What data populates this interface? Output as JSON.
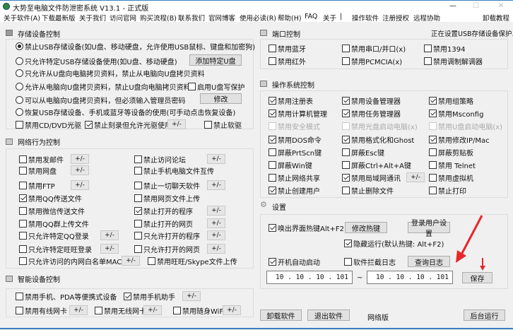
{
  "window": {
    "title": "大势至电脑文件防泄密系统 V13.1 - 正式版",
    "minimize": "—",
    "maximize": "☐",
    "close": "✕"
  },
  "menu": [
    "关于软件(A)",
    "下载最新版",
    "关于我们",
    "访问官网",
    "购买流程(B)",
    "联系我们",
    "官网博客",
    "使用必读(R)",
    "帮助(H)",
    "FAQ",
    "关于",
    "|",
    "操作软件",
    "注册授权",
    "远程协助",
    "卸载教程"
  ],
  "storage": {
    "title": "存储设备控制",
    "radios": [
      {
        "label": "禁止USB存储设备(如U盘、移动硬盘，允许使用USB鼠标、键盘和加密狗)",
        "checked": true
      },
      {
        "label": "只允许特定USB存储设备使用(如U盘、移动硬盘)",
        "checked": false
      },
      {
        "label": "只允许从U盘向电脑拷贝资料，禁止从电脑向U盘拷贝资料",
        "checked": false
      },
      {
        "label": "允许从电脑向U盘拷贝资料，禁止U盘向电脑拷贝资料",
        "checked": false
      },
      {
        "label": "可以从电脑向U盘拷贝资料，但必须输入管理员密码",
        "checked": false
      },
      {
        "label": "恢复USB存储设备、手机或蓝牙等设备的使用(可手动点击恢复设备)",
        "checked": false
      }
    ],
    "add_usb_button": "添加特定U盘",
    "modify_button": "修改",
    "write_protect": {
      "label": "启用U盘写保护",
      "checked": false
    },
    "cd": {
      "label": "禁用CD/DVD光驱",
      "checked": false
    },
    "burn": {
      "label": "禁止刻录但允许光驱使用",
      "checked": true
    },
    "floppy": {
      "label": "禁止软驱",
      "checked": false
    },
    "pm": "+/-"
  },
  "network": {
    "title": "网络行为控制",
    "items": [
      {
        "label": "禁用发邮件",
        "checked": false
      },
      {
        "label": "禁用网盘",
        "checked": false
      },
      {
        "label": "禁用FTP",
        "checked": false
      },
      {
        "label": "禁用QQ传送文件",
        "checked": true
      },
      {
        "label": "禁用微信传送文件",
        "checked": false
      },
      {
        "label": "禁用QQ群上传文件",
        "checked": false
      },
      {
        "label": "只允许特定QQ登录",
        "checked": false
      },
      {
        "label": "只允许特定旺旺登录",
        "checked": false
      },
      {
        "label": "只允许访问的内网白名单MAC列表",
        "checked": false
      },
      {
        "label": "禁止访问论坛",
        "checked": false
      },
      {
        "label": "禁止手机电脑文件互传",
        "checked": false
      },
      {
        "label": "禁止一切聊天软件",
        "checked": false
      },
      {
        "label": "禁用网页文件上传",
        "checked": false
      },
      {
        "label": "禁止打开的程序",
        "checked": true
      },
      {
        "label": "禁止打开的网页",
        "checked": false
      },
      {
        "label": "只允许打开的程序",
        "checked": false
      },
      {
        "label": "只允许打开的网页",
        "checked": false
      },
      {
        "label": "禁用旺旺/Skype文件上传",
        "checked": false
      }
    ]
  },
  "smart": {
    "title": "智能设备控制",
    "items": [
      {
        "label": "禁用手机、PDA等便携式设备",
        "checked": false
      },
      {
        "label": "禁用手机助手",
        "checked": true
      },
      {
        "label": "禁用有线网卡",
        "checked": false
      },
      {
        "label": "禁用无线网卡",
        "checked": false
      },
      {
        "label": "禁用随身WiFi",
        "checked": false
      }
    ]
  },
  "port": {
    "title": "端口控制",
    "status": "正在设置USB存储设备保护...",
    "items": [
      {
        "label": "禁用蓝牙",
        "checked": false
      },
      {
        "label": "禁用串口/并口(x)",
        "checked": false
      },
      {
        "label": "禁用1394",
        "checked": false
      },
      {
        "label": "禁用红外",
        "checked": false
      },
      {
        "label": "禁用PCMCIA(x)",
        "checked": false
      },
      {
        "label": "禁用调制解调器",
        "checked": false
      }
    ]
  },
  "os": {
    "title": "操作系统控制",
    "items": [
      {
        "label": "禁用注册表",
        "checked": true
      },
      {
        "label": "禁用设备管理器",
        "checked": true
      },
      {
        "label": "禁用组策略",
        "checked": true
      },
      {
        "label": "禁用计算机管理",
        "checked": true
      },
      {
        "label": "禁用任务管理器",
        "checked": true
      },
      {
        "label": "禁用Msconfig",
        "checked": true
      },
      {
        "label": "禁用安全模式",
        "checked": false
      },
      {
        "label": "禁用光盘启动电脑(x)",
        "checked": false
      },
      {
        "label": "禁用U盘启动电脑(x)",
        "checked": false
      },
      {
        "label": "禁用DOS命令",
        "checked": true
      },
      {
        "label": "禁用格式化和Ghost",
        "checked": true
      },
      {
        "label": "禁用修改IP/Mac",
        "checked": true
      },
      {
        "label": "屏蔽PrtScn键",
        "checked": false
      },
      {
        "label": "屏蔽Esc键",
        "checked": false
      },
      {
        "label": "屏蔽剪贴板",
        "checked": false
      },
      {
        "label": "屏蔽Win键",
        "checked": false
      },
      {
        "label": "屏蔽Ctrl+Alt+A键",
        "checked": false
      },
      {
        "label": "禁用 Telnet",
        "checked": false
      },
      {
        "label": "禁止网络共享",
        "checked": false
      },
      {
        "label": "禁用局域网通讯",
        "checked": true
      },
      {
        "label": "禁用虚拟机",
        "checked": false
      },
      {
        "label": "禁止创建用户",
        "checked": true
      },
      {
        "label": "禁止删除文件",
        "checked": false
      },
      {
        "label": "禁止打印",
        "checked": false
      }
    ]
  },
  "settings": {
    "title": "设置",
    "hotkey": {
      "label": "唤出界面热键Alt+F2",
      "checked": true
    },
    "modify_hotkey": "修改热键",
    "login_user": "登录用户设置",
    "hidden": {
      "label": "隐藏运行(默认热键: Alt+F2)",
      "checked": true
    },
    "autostart": {
      "label": "开机自动启动",
      "checked": true
    },
    "log": {
      "label": "软件拦截日志",
      "checked": false
    },
    "query_log": "查询日志",
    "ip_start": "10  .  10  .  10  . 101",
    "ip_sep": "~",
    "ip_end": "10  .  10  .  10  . 101",
    "save": "保存"
  },
  "footer": {
    "uninstall": "卸载软件",
    "exit": "退出软件",
    "edition": "网络版",
    "background": "后台运行"
  },
  "colors": {
    "accent": "#3c7fc4",
    "arrow": "#e8262a"
  }
}
